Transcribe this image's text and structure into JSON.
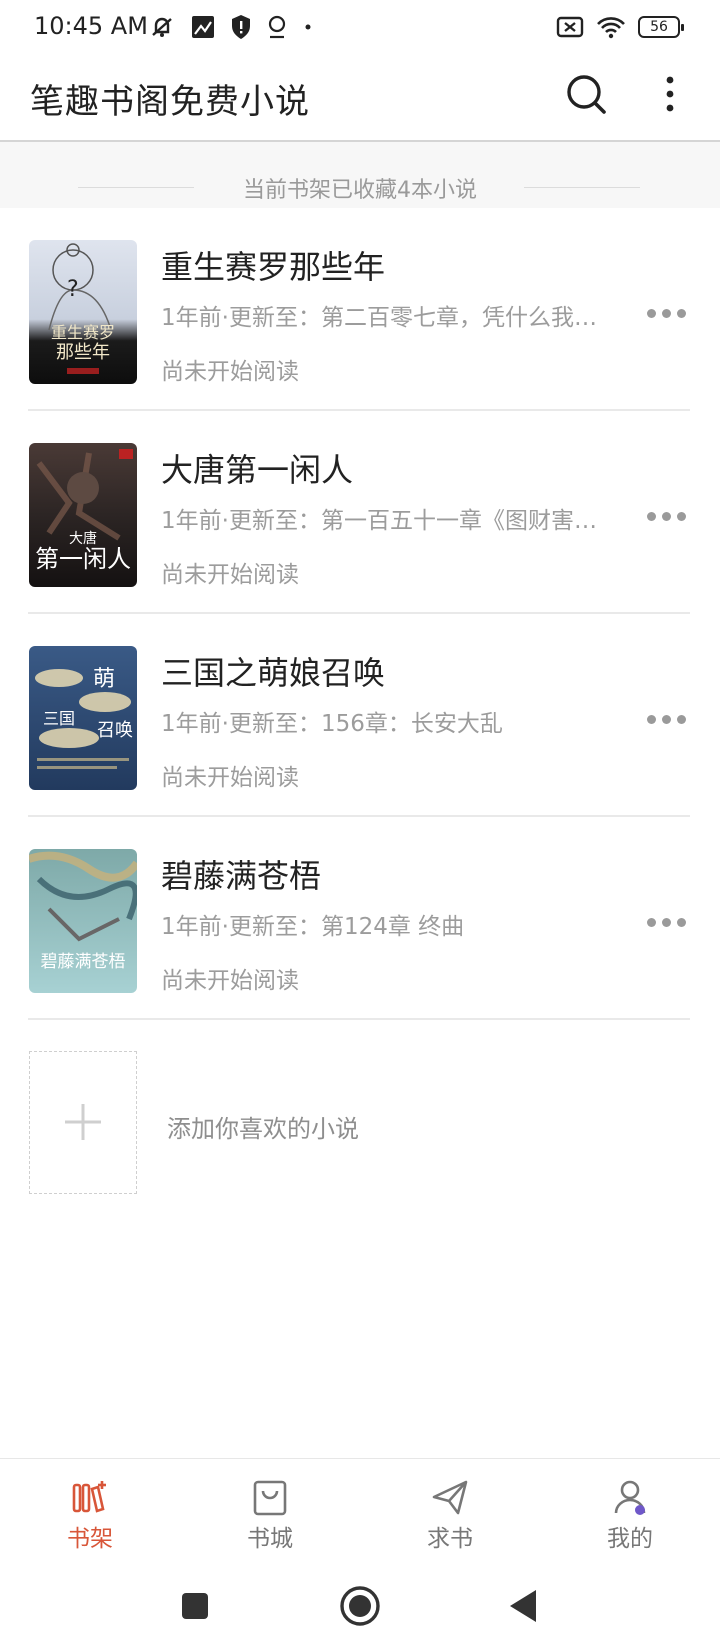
{
  "status_bar": {
    "time": "10:45 AM",
    "battery": "56"
  },
  "header": {
    "title": "笔趣书阁免费小说"
  },
  "shelf": {
    "summary": "当前书架已收藏4本小说"
  },
  "books": [
    {
      "title": "重生赛罗那些年",
      "update": "1年前·更新至：第二百零七章，凭什么我…",
      "progress": "尚未开始阅读",
      "cover_text": "重生赛罗那些年"
    },
    {
      "title": "大唐第一闲人",
      "update": "1年前·更新至：第一百五十一章《图财害…",
      "progress": "尚未开始阅读",
      "cover_text": "大唐第一闲人"
    },
    {
      "title": "三国之萌娘召唤",
      "update": "1年前·更新至：156章：长安大乱",
      "progress": "尚未开始阅读",
      "cover_text": "三国萌娘召唤"
    },
    {
      "title": "碧藤满苍梧",
      "update": "1年前·更新至：第124章 终曲",
      "progress": "尚未开始阅读",
      "cover_text": "碧藤满苍梧"
    }
  ],
  "add_book": {
    "label": "添加你喜欢的小说"
  },
  "bottom_nav": [
    {
      "label": "书架",
      "icon": "bookshelf-icon",
      "active": true
    },
    {
      "label": "书城",
      "icon": "store-bag-icon",
      "active": false
    },
    {
      "label": "求书",
      "icon": "paper-plane-icon",
      "active": false
    },
    {
      "label": "我的",
      "icon": "profile-icon",
      "active": false
    }
  ],
  "colors": {
    "accent": "#d85639",
    "secondary_text": "#9c9c9c",
    "divider": "#e9e9e9"
  }
}
